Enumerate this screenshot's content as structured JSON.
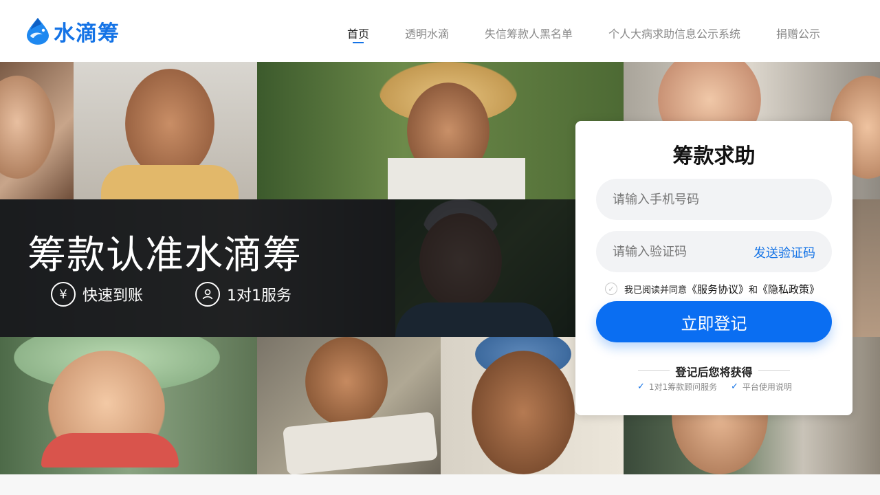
{
  "brand": {
    "logo_text": "水滴筹",
    "accent": "#1473e6"
  },
  "nav": {
    "items": [
      {
        "label": "首页",
        "active": true
      },
      {
        "label": "透明水滴",
        "active": false
      },
      {
        "label": "失信筹款人黑名单",
        "active": false
      },
      {
        "label": "个人大病求助信息公示系统",
        "active": false
      },
      {
        "label": "捐赠公示",
        "active": false
      }
    ]
  },
  "hero": {
    "slogan": "筹款认准水滴筹",
    "features": [
      {
        "icon": "yuan-icon",
        "label": "快速到账"
      },
      {
        "icon": "person-icon",
        "label": "1对1服务"
      }
    ]
  },
  "login": {
    "title": "筹款求助",
    "phone_placeholder": "请输入手机号码",
    "code_placeholder": "请输入验证码",
    "send_code": "发送验证码",
    "agree_prefix": "我已阅读并同意",
    "service_agreement": "《服务协议》",
    "and": "和",
    "privacy_policy": "《隐私政策》",
    "agreed": false,
    "submit": "立即登记",
    "benefits_title": "登记后您将获得",
    "benefits": [
      "1对1筹款顾问服务",
      "平台使用说明"
    ],
    "button_color": "#0a6ef2"
  }
}
